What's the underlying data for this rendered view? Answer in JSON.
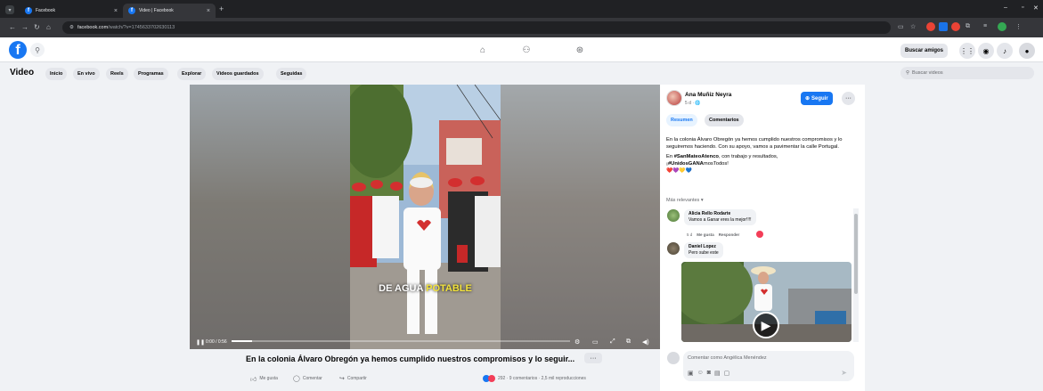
{
  "browser": {
    "tabs": [
      {
        "label": "Facebook"
      },
      {
        "label": "Video | Facebook"
      }
    ],
    "url_domain": "facebook.com",
    "url_path": "/watch/?v=1745633702630113",
    "window_controls": {
      "minimize": "–",
      "maximize": "▫",
      "close": "✕"
    }
  },
  "header": {
    "buscar_amigos": "Buscar amigos"
  },
  "video_nav": {
    "title": "Video",
    "pills": [
      "Inicio",
      "En vivo",
      "Reels",
      "Programas",
      "Explorar",
      "Videos guardados",
      "Seguidas"
    ],
    "search_placeholder": "Buscar videos"
  },
  "player": {
    "caption_part1": "DE AGUA",
    "caption_part2": "POTABLE",
    "time": "0:00 / 0:56",
    "progress_fraction": 0.06
  },
  "post": {
    "title": "En la colonia Álvaro Obregón ya hemos cumplido nuestros compromisos y lo seguir...",
    "more_button": "···",
    "actions": {
      "like": "Me gusta",
      "comment": "Comentar",
      "share": "Compartir"
    },
    "stats": "292 · 9 comentarios · 2,5 mil reproducciones"
  },
  "author": {
    "name": "Ana Muñiz Neyra",
    "meta": "5 d · 🌐",
    "follow_label": "Seguir",
    "more": "···"
  },
  "right_tabs": {
    "summary": "Resumen",
    "comments": "Comentarios"
  },
  "description": {
    "para1": "En la colonia Álvaro Obregón ya hemos cumplido nuestros compromisos y lo seguiremos haciendo. Con su apoyo, vamos a pavimentar la calle Portugal.",
    "para2_prefix": "En ",
    "hashtag1": "#SanMateoAtenco",
    "para2_mid": ", con trabajo y resultados,",
    "para2_excl": "¡",
    "hashtag2_a": "#UnidosGANA",
    "hashtag2_b": "mosTodos",
    "para2_end": "!",
    "emoji": "❤️💜💛💙"
  },
  "comments": {
    "sort_label": "Más relevantes ▾",
    "items": [
      {
        "author": "Alicia Rello Rodarte",
        "text": "Vamos a Ganar eres la mejor!!!!",
        "time": "5 d",
        "like": "Me gusta",
        "reply": "Responder"
      },
      {
        "author": "Daniel Lopez",
        "text": "Pero sube este"
      }
    ],
    "input_placeholder": "Comentar como Angélica Menéndez"
  },
  "colors": {
    "brand": "#1877f2",
    "reaction_love": "#f33e58",
    "chrome_dark": "#202124"
  }
}
